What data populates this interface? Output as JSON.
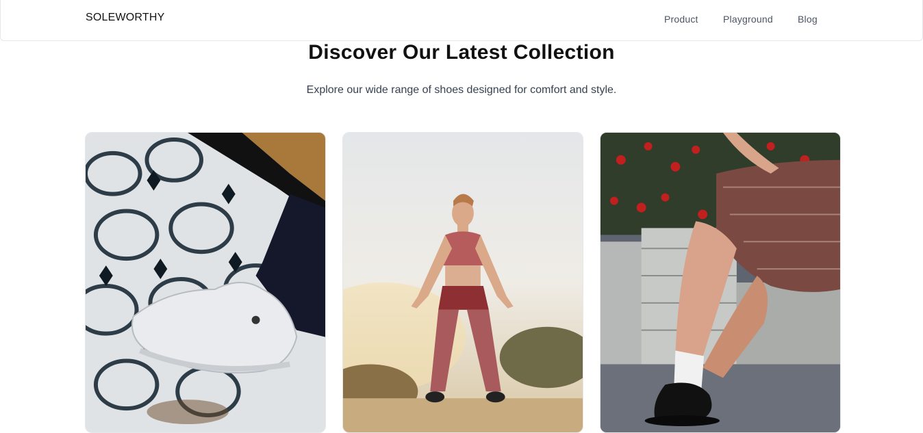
{
  "header": {
    "brand": "SOLEWORTHY",
    "nav": [
      {
        "label": "Product"
      },
      {
        "label": "Playground"
      },
      {
        "label": "Blog"
      }
    ]
  },
  "hero": {
    "title": "Discover Our Latest Collection",
    "subtitle": "Explore our wide range of shoes designed for comfort and style."
  },
  "products": [
    {
      "image": "white-sneaker-on-patterned-tiles"
    },
    {
      "image": "woman-in-red-activewear-outdoors"
    },
    {
      "image": "black-loafers-with-white-socks"
    }
  ],
  "colors": {
    "text_primary": "#111111",
    "text_secondary": "#374151",
    "nav_text": "#4b5563",
    "border": "#e5e7eb"
  }
}
